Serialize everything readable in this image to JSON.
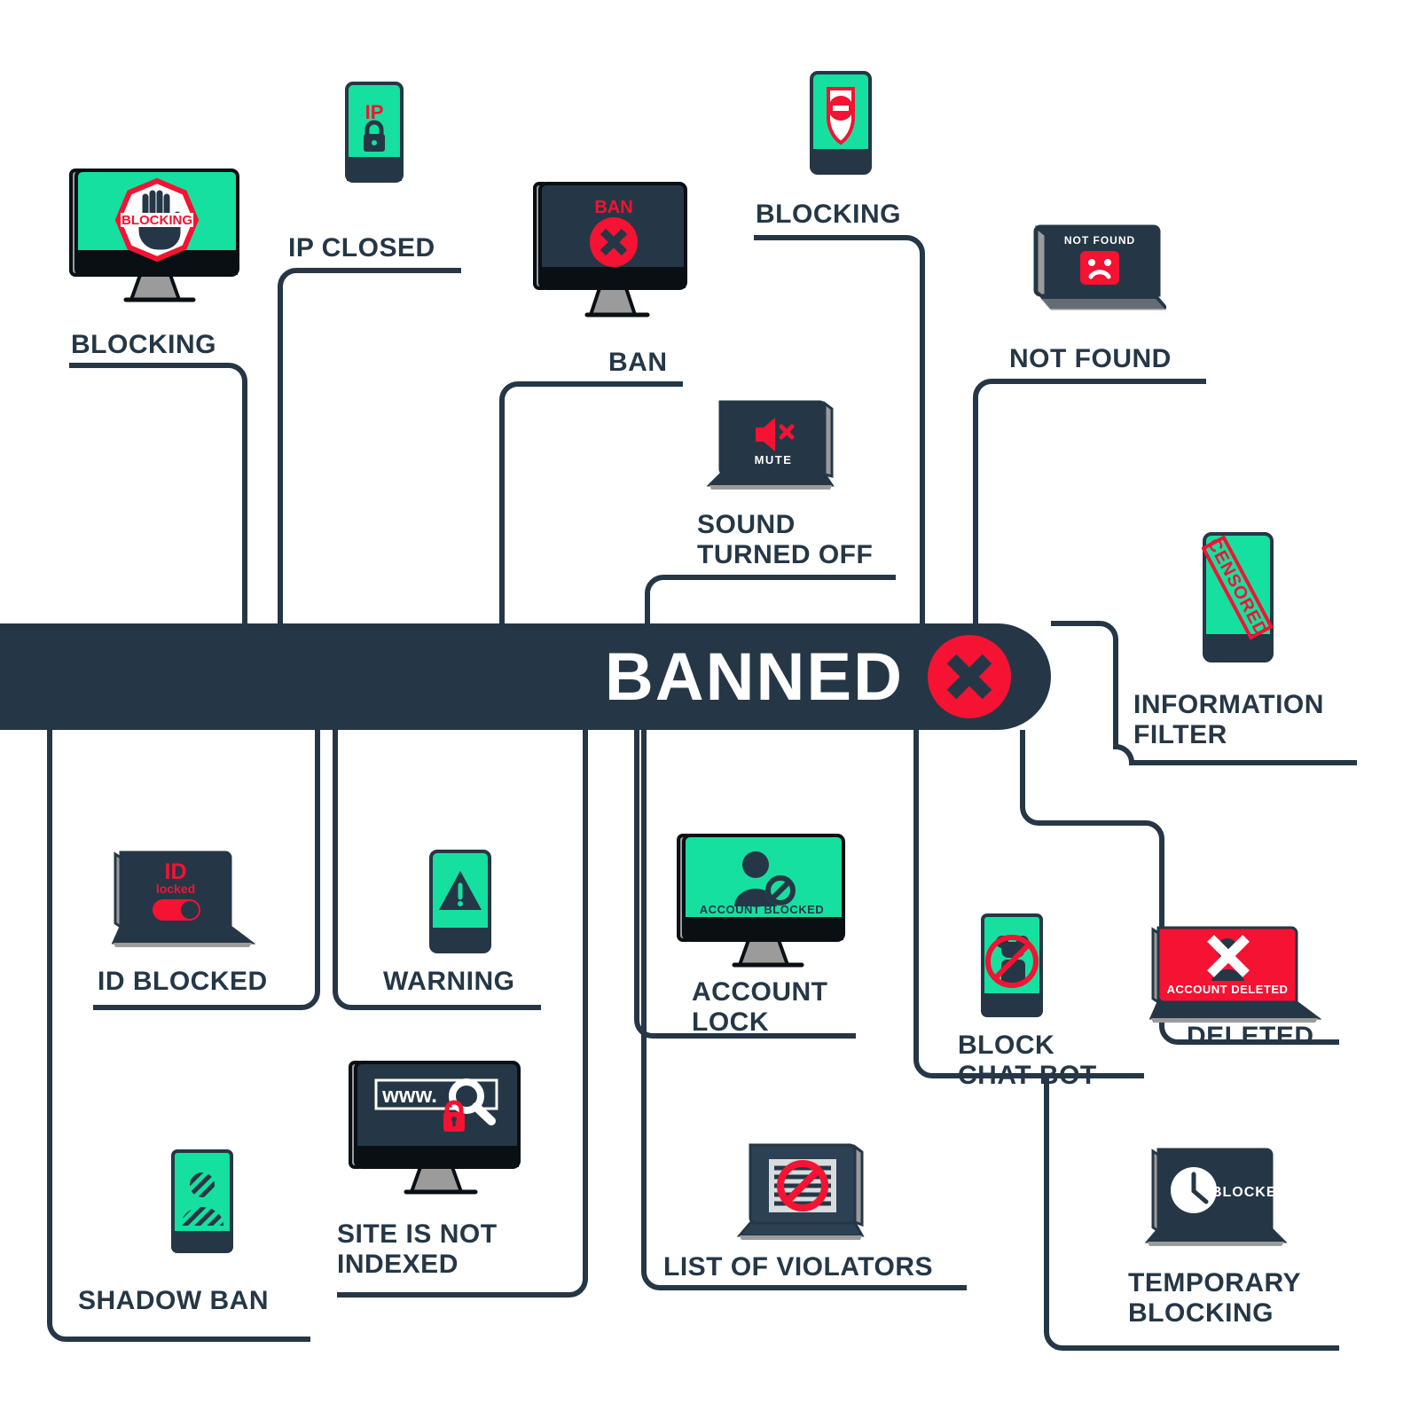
{
  "palette": {
    "navy": "#253746",
    "green": "#16E0A0",
    "red": "#F51232",
    "white": "#ffffff",
    "grey": "#9b9b9b",
    "black": "#0a0f14",
    "light": "#d9dcdd"
  },
  "banner": {
    "title": "BANNED",
    "badge_icon": "x-circle-icon"
  },
  "nodes": [
    {
      "id": "blocking-monitor",
      "label": "BLOCKING",
      "device": "monitor",
      "screen_text": "BLOCKING",
      "icon": "stop-hand-icon"
    },
    {
      "id": "ip-closed",
      "label": "IP CLOSED",
      "device": "phone",
      "screen_text": "IP",
      "icon": "padlock-icon"
    },
    {
      "id": "ban",
      "label": "BAN",
      "device": "monitor",
      "screen_text": "BAN",
      "icon": "x-circle-icon"
    },
    {
      "id": "blocking-phone",
      "label": "BLOCKING",
      "device": "phone",
      "screen_text": "",
      "icon": "shield-no-entry-icon"
    },
    {
      "id": "not-found",
      "label": "NOT FOUND",
      "device": "laptop",
      "screen_text": "NOT FOUND",
      "icon": "sad-face-icon"
    },
    {
      "id": "sound-turned-off",
      "label": "SOUND\nTURNED OFF",
      "device": "laptop",
      "screen_text": "MUTE",
      "icon": "speaker-mute-icon"
    },
    {
      "id": "information-filter",
      "label": "INFORMATION\nFILTER",
      "device": "phone",
      "screen_text": "CENSORED",
      "icon": "censored-stamp-icon"
    },
    {
      "id": "id-blocked",
      "label": "ID BLOCKED",
      "device": "laptop",
      "screen_text": "ID locked",
      "icon": "toggle-switch-icon"
    },
    {
      "id": "warning",
      "label": "WARNING",
      "device": "phone",
      "screen_text": "",
      "icon": "warning-triangle-icon"
    },
    {
      "id": "account-lock",
      "label": "ACCOUNT\nLOCK",
      "device": "monitor",
      "screen_text": "ACCOUNT BLOCKED",
      "icon": "user-blocked-icon"
    },
    {
      "id": "block-chat-bot",
      "label": "BLOCK\nCHAT BOT",
      "device": "phone",
      "screen_text": "",
      "icon": "no-robot-icon"
    },
    {
      "id": "deleted",
      "label": "DELETED",
      "device": "laptop",
      "screen_text": "ACCOUNT DELETED",
      "icon": "user-x-icon"
    },
    {
      "id": "shadow-ban",
      "label": "SHADOW BAN",
      "device": "phone",
      "screen_text": "",
      "icon": "hatched-user-icon"
    },
    {
      "id": "site-is-not-indexed",
      "label": "SITE IS NOT\nINDEXED",
      "device": "monitor",
      "screen_text": "www.",
      "icon": "search-lock-icon"
    },
    {
      "id": "list-of-violators",
      "label": "LIST OF VIOLATORS",
      "device": "laptop",
      "screen_text": "",
      "icon": "no-entry-list-icon"
    },
    {
      "id": "temporary-blocking",
      "label": "TEMPORARY\nBLOCKING",
      "device": "laptop",
      "screen_text": "BLOCKED",
      "icon": "clock-icon"
    }
  ]
}
